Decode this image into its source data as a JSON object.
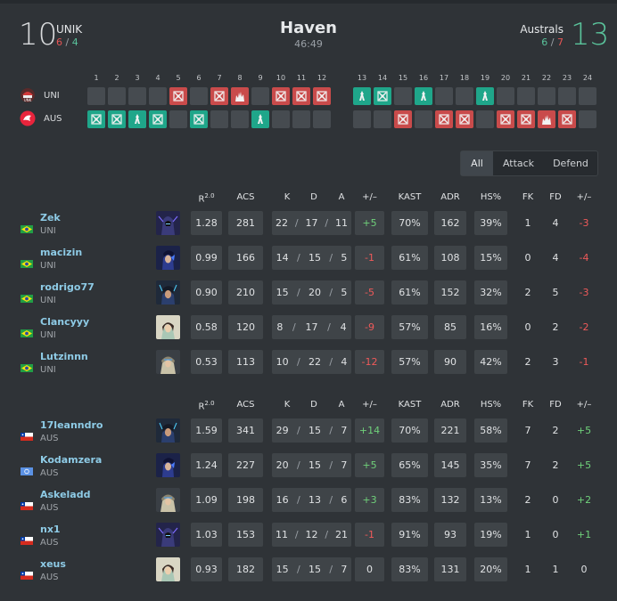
{
  "match": {
    "map": "Haven",
    "duration": "46:49"
  },
  "team1": {
    "name": "UNIK",
    "score": "10",
    "half_attack": "6",
    "half_defend": "4",
    "short": "UNI"
  },
  "team2": {
    "name": "Australs",
    "score": "13",
    "half_attack": "6",
    "half_defend": "7",
    "short": "AUS"
  },
  "rounds": {
    "numbers": [
      "1",
      "2",
      "3",
      "4",
      "5",
      "6",
      "7",
      "8",
      "9",
      "10",
      "11",
      "12",
      "13",
      "14",
      "15",
      "16",
      "17",
      "18",
      "19",
      "20",
      "21",
      "22",
      "23",
      "24"
    ],
    "team1": [
      "",
      "",
      "",
      "",
      "elim-r",
      "",
      "elim-r",
      "spike-r",
      "",
      "elim-r",
      "elim-r",
      "elim-r",
      "defuse-g",
      "elim-g",
      "",
      "defuse-g",
      "",
      "",
      "defuse-g",
      "",
      "",
      "",
      "",
      ""
    ],
    "team2": [
      "elim-g",
      "elim-g",
      "defuse-g",
      "elim-g",
      "",
      "elim-g",
      "",
      "",
      "defuse-g",
      "",
      "",
      "",
      "",
      "",
      "elim-r",
      "",
      "elim-r",
      "elim-r",
      "",
      "elim-r",
      "elim-r",
      "spike-r",
      "elim-r",
      ""
    ]
  },
  "filters": [
    "All",
    "Attack",
    "Defend"
  ],
  "active_filter": "All",
  "headers": {
    "rating": "R",
    "rating_sup": "2.0",
    "acs": "ACS",
    "k": "K",
    "d": "D",
    "a": "A",
    "pm": "+/–",
    "kast": "KAST",
    "adr": "ADR",
    "hs": "HS%",
    "fk": "FK",
    "fd": "FD",
    "fpm": "+/–"
  },
  "players1": [
    {
      "name": "Zek",
      "team": "UNI",
      "flag": "br",
      "agent": "omen",
      "rating": "1.28",
      "acs": "281",
      "k": "22",
      "d": "17",
      "a": "11",
      "pm": "+5",
      "kast": "70%",
      "adr": "162",
      "hs": "39%",
      "fk": "1",
      "fd": "4",
      "fpm": "-3"
    },
    {
      "name": "macizin",
      "team": "UNI",
      "flag": "br",
      "agent": "yoru",
      "rating": "0.99",
      "acs": "166",
      "k": "14",
      "d": "15",
      "a": "5",
      "pm": "-1",
      "kast": "61%",
      "adr": "108",
      "hs": "15%",
      "fk": "0",
      "fd": "4",
      "fpm": "-4"
    },
    {
      "name": "rodrigo77",
      "team": "UNI",
      "flag": "br",
      "agent": "neon",
      "rating": "0.90",
      "acs": "210",
      "k": "15",
      "d": "20",
      "a": "5",
      "pm": "-5",
      "kast": "61%",
      "adr": "152",
      "hs": "32%",
      "fk": "2",
      "fd": "5",
      "fpm": "-3"
    },
    {
      "name": "Clancyyy",
      "team": "UNI",
      "flag": "br",
      "agent": "sage",
      "rating": "0.58",
      "acs": "120",
      "k": "8",
      "d": "17",
      "a": "4",
      "pm": "-9",
      "kast": "57%",
      "adr": "85",
      "hs": "16%",
      "fk": "0",
      "fd": "2",
      "fpm": "-2"
    },
    {
      "name": "Lutzinnn",
      "team": "UNI",
      "flag": "br",
      "agent": "sova",
      "rating": "0.53",
      "acs": "113",
      "k": "10",
      "d": "22",
      "a": "4",
      "pm": "-12",
      "kast": "57%",
      "adr": "90",
      "hs": "42%",
      "fk": "2",
      "fd": "3",
      "fpm": "-1"
    }
  ],
  "players2": [
    {
      "name": "17leanndro",
      "team": "AUS",
      "flag": "cl",
      "agent": "neon",
      "rating": "1.59",
      "acs": "341",
      "k": "29",
      "d": "15",
      "a": "7",
      "pm": "+14",
      "kast": "70%",
      "adr": "221",
      "hs": "58%",
      "fk": "7",
      "fd": "2",
      "fpm": "+5"
    },
    {
      "name": "Kodamzera",
      "team": "AUS",
      "flag": "un",
      "agent": "yoru",
      "rating": "1.24",
      "acs": "227",
      "k": "20",
      "d": "15",
      "a": "7",
      "pm": "+5",
      "kast": "65%",
      "adr": "145",
      "hs": "35%",
      "fk": "7",
      "fd": "2",
      "fpm": "+5"
    },
    {
      "name": "Askeladd",
      "team": "AUS",
      "flag": "cl",
      "agent": "sova",
      "rating": "1.09",
      "acs": "198",
      "k": "16",
      "d": "13",
      "a": "6",
      "pm": "+3",
      "kast": "83%",
      "adr": "132",
      "hs": "13%",
      "fk": "2",
      "fd": "0",
      "fpm": "+2"
    },
    {
      "name": "nx1",
      "team": "AUS",
      "flag": "cl",
      "agent": "omen",
      "rating": "1.03",
      "acs": "153",
      "k": "11",
      "d": "12",
      "a": "21",
      "pm": "-1",
      "kast": "91%",
      "adr": "93",
      "hs": "19%",
      "fk": "1",
      "fd": "0",
      "fpm": "+1"
    },
    {
      "name": "xeus",
      "team": "AUS",
      "flag": "cl",
      "agent": "sage",
      "rating": "0.93",
      "acs": "182",
      "k": "15",
      "d": "15",
      "a": "7",
      "pm": "0",
      "kast": "83%",
      "adr": "131",
      "hs": "20%",
      "fk": "1",
      "fd": "1",
      "fpm": "0"
    }
  ]
}
